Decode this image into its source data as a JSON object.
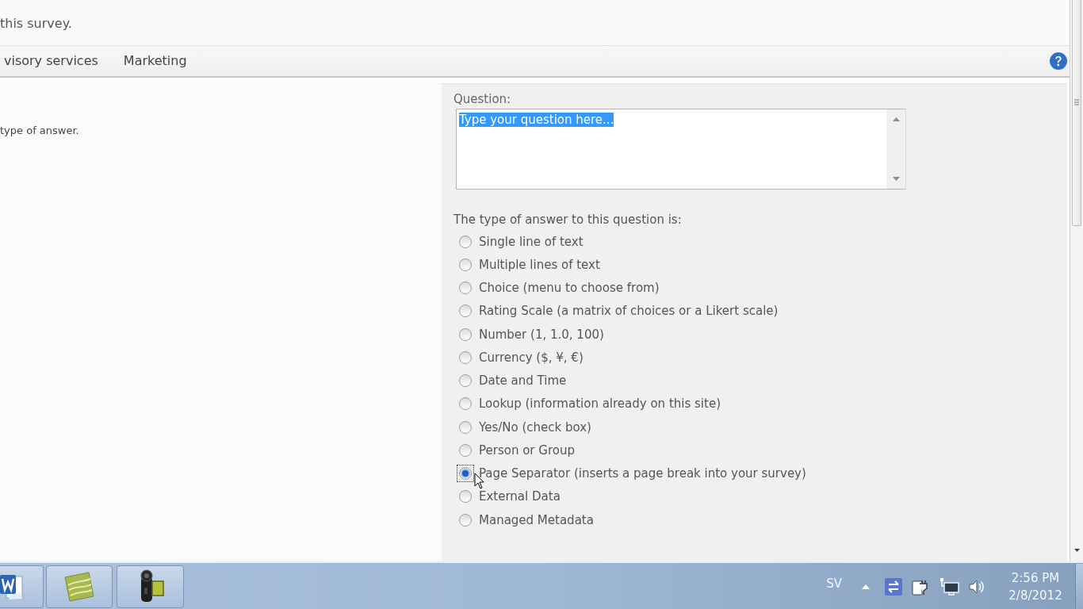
{
  "header": {
    "description": "this survey."
  },
  "navigation": {
    "links": [
      {
        "label": "visory services"
      },
      {
        "label": "Marketing"
      }
    ]
  },
  "left_pane": {
    "description": "type of answer."
  },
  "question": {
    "label": "Question:",
    "value": "Type your question here...",
    "value_selected": true
  },
  "answer_type": {
    "label": "The type of answer to this question is:",
    "options": [
      {
        "label": "Single line of text",
        "selected": false
      },
      {
        "label": "Multiple lines of text",
        "selected": false
      },
      {
        "label": "Choice (menu to choose from)",
        "selected": false
      },
      {
        "label": "Rating Scale (a matrix of choices or a Likert scale)",
        "selected": false
      },
      {
        "label": "Number (1, 1.0, 100)",
        "selected": false
      },
      {
        "label": "Currency ($, ¥, €)",
        "selected": false
      },
      {
        "label": "Date and Time",
        "selected": false
      },
      {
        "label": "Lookup (information already on this site)",
        "selected": false
      },
      {
        "label": "Yes/No (check box)",
        "selected": false
      },
      {
        "label": "Person or Group",
        "selected": false
      },
      {
        "label": "Page Separator (inserts a page break into your survey)",
        "selected": true
      },
      {
        "label": "External Data",
        "selected": false
      },
      {
        "label": "Managed Metadata",
        "selected": false
      }
    ]
  },
  "taskbar": {
    "language": "SV",
    "clock": {
      "time": "2:56 PM",
      "date": "2/8/2012"
    }
  }
}
